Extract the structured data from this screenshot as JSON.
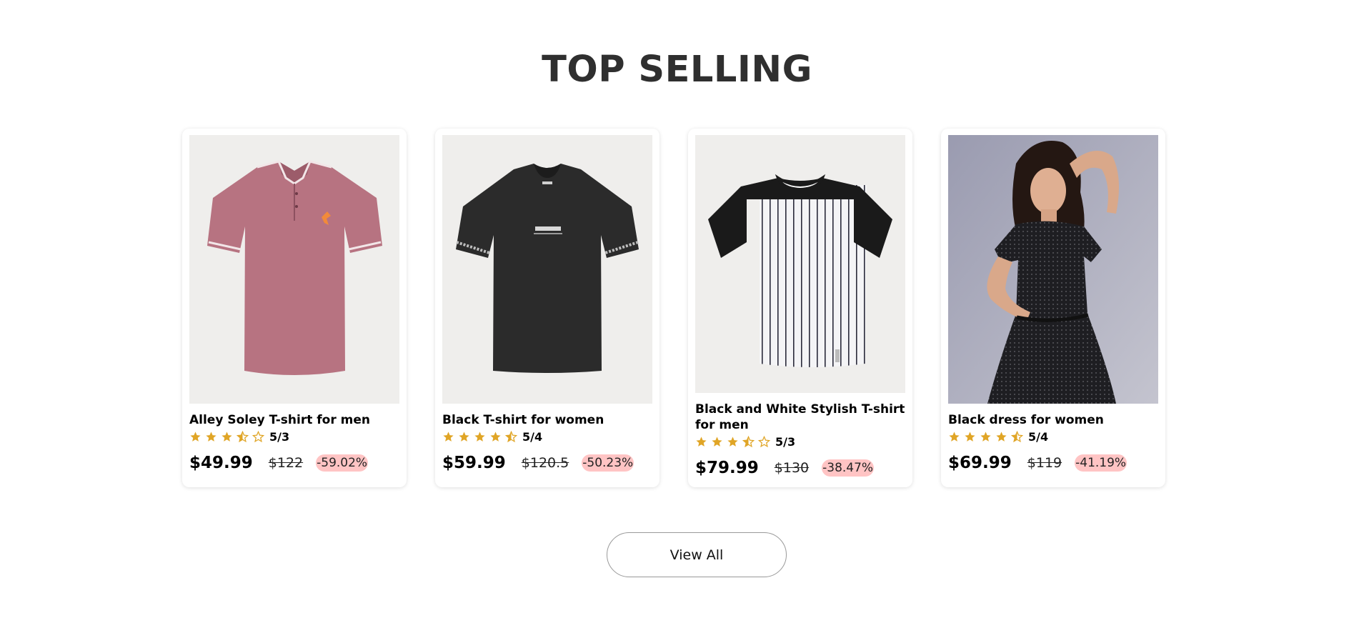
{
  "section": {
    "title": "TOP SELLING"
  },
  "products": [
    {
      "title": "Alley Soley T-shirt for men",
      "rating_text": "5/3",
      "stars": [
        "full",
        "full",
        "full",
        "half",
        "empty"
      ],
      "price": "$49.99",
      "old_price": "$122",
      "discount": "-59.02%",
      "image": "pink-polo-shirt"
    },
    {
      "title": "Black T-shirt for women",
      "rating_text": "5/4",
      "stars": [
        "full",
        "full",
        "full",
        "full",
        "half"
      ],
      "price": "$59.99",
      "old_price": "$120.5",
      "discount": "-50.23%",
      "image": "black-tshirt"
    },
    {
      "title": "Black and White Stylish T-shirt for men",
      "rating_text": "5/3",
      "stars": [
        "full",
        "full",
        "full",
        "half",
        "empty"
      ],
      "price": "$79.99",
      "old_price": "$130",
      "discount": "-38.47%",
      "image": "striped-raglan-tshirt"
    },
    {
      "title": "Black dress for women",
      "rating_text": "5/4",
      "stars": [
        "full",
        "full",
        "full",
        "full",
        "half"
      ],
      "price": "$69.99",
      "old_price": "$119",
      "discount": "-41.19%",
      "image": "woman-black-dress"
    }
  ],
  "view_all": {
    "label": "View All"
  },
  "colors": {
    "star": "#e0a526",
    "discount_bg": "#ffc4c4",
    "title": "#2f2f2f"
  }
}
